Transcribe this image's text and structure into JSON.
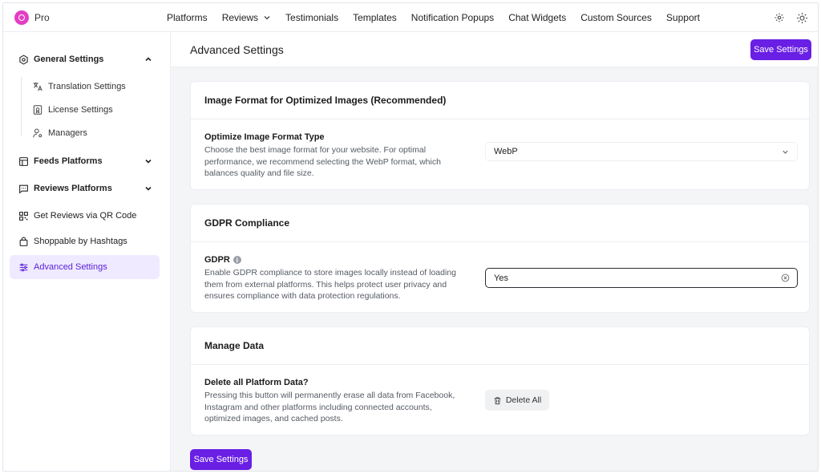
{
  "brand": {
    "text": "Pro"
  },
  "nav": {
    "items": [
      "Platforms",
      "Reviews",
      "Testimonials",
      "Templates",
      "Notification Popups",
      "Chat Widgets",
      "Custom Sources",
      "Support"
    ]
  },
  "sidebar": {
    "general": "General Settings",
    "translation": "Translation Settings",
    "license": "License Settings",
    "managers": "Managers",
    "feeds": "Feeds Platforms",
    "reviews": "Reviews Platforms",
    "qr": "Get Reviews via QR Code",
    "shoppable": "Shoppable by Hashtags",
    "advanced": "Advanced Settings"
  },
  "main": {
    "title": "Advanced Settings",
    "save_label": "Save Settings",
    "cards": {
      "image": {
        "title": "Image Format for Optimized Images (Recommended)",
        "label": "Optimize Image Format Type",
        "desc": "Choose the best image format for your website. For optimal performance, we recommend selecting the WebP format, which balances quality and file size.",
        "value": "WebP"
      },
      "gdpr": {
        "title": "GDPR Compliance",
        "label": "GDPR",
        "desc": "Enable GDPR compliance to store images locally instead of loading them from external platforms. This helps protect user privacy and ensures compliance with data protection regulations.",
        "value": "Yes"
      },
      "data": {
        "title": "Manage Data",
        "label": "Delete all Platform Data?",
        "desc": "Pressing this button will permanently erase all data from Facebook, Instagram and other platforms including connected accounts, optimized images, and cached posts.",
        "button": "Delete All"
      }
    }
  },
  "colors": {
    "accent": "#6a1fe5",
    "active_bg": "#efeaff",
    "logo": "#e33ec4"
  }
}
